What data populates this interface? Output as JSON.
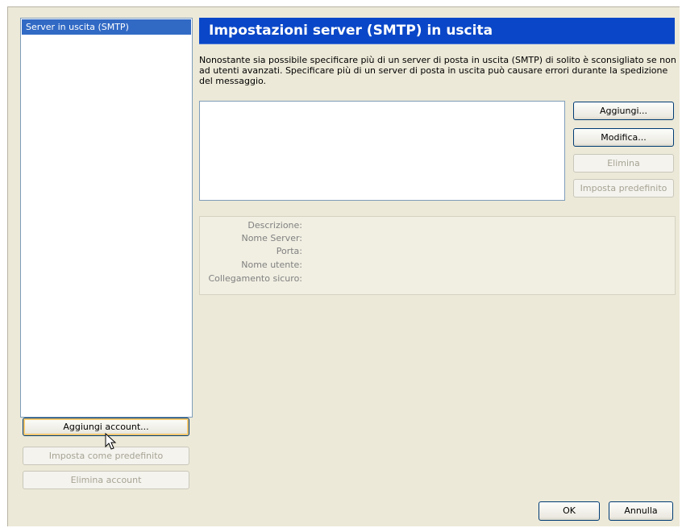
{
  "accounts": {
    "items": [
      {
        "label": "Server in uscita (SMTP)",
        "selected": true
      }
    ],
    "add_account": "Aggiungi account...",
    "set_default": "Imposta come predefinito",
    "delete_account": "Elimina account"
  },
  "panel": {
    "title": "Impostazioni server (SMTP) in uscita",
    "description": "Nonostante sia possibile specificare più di un server di posta in uscita (SMTP) di solito è sconsigliato se non ad utenti avanzati. Specificare più di un server di posta in uscita può causare errori durante la spedizione del messaggio.",
    "buttons": {
      "add": "Aggiungi...",
      "edit": "Modifica...",
      "delete": "Elimina",
      "set_default": "Imposta predefinito"
    },
    "details": {
      "description": "Descrizione:",
      "server_name": "Nome Server:",
      "port": "Porta:",
      "username": "Nome utente:",
      "secure": "Collegamento sicuro:"
    }
  },
  "footer": {
    "ok": "OK",
    "cancel": "Annulla"
  },
  "colors": {
    "header_bg": "#0a47c8",
    "selection_bg": "#316ac5",
    "dialog_bg": "#ece9d8"
  }
}
